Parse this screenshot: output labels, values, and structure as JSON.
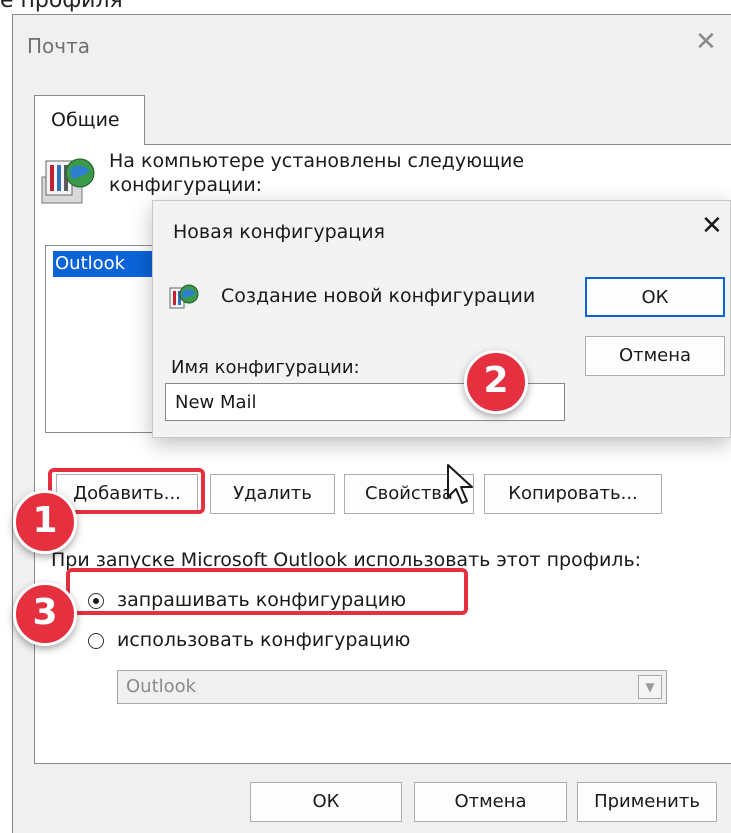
{
  "caption": "е профиля",
  "window": {
    "title": "Почта",
    "close_icon": "close-icon"
  },
  "tabs": [
    {
      "label": "Общие"
    }
  ],
  "intro_text": "На компьютере установлены следующие конфигурации:",
  "profiles": [
    "Outlook"
  ],
  "buttons": {
    "add": "Добавить...",
    "delete": "Удалить",
    "properties": "Свойства",
    "copy": "Копировать..."
  },
  "startup": {
    "label": "При запуске Microsoft Outlook использовать этот профиль:",
    "option_prompt": "запрашивать конфигурацию",
    "option_use": "использовать конфигурацию",
    "selected": "prompt",
    "combo_value": "Outlook"
  },
  "footer": {
    "ok": "ОК",
    "cancel": "Отмена",
    "apply": "Применить"
  },
  "new_profile_dialog": {
    "title": "Новая конфигурация",
    "create_text": "Создание новой конфигурации",
    "name_label": "Имя конфигурации:",
    "name_value": "New Mail",
    "ok": "ОК",
    "cancel": "Отмена"
  },
  "annotations": {
    "step1": "1",
    "step2": "2",
    "step3": "3",
    "color": "#e53040"
  }
}
